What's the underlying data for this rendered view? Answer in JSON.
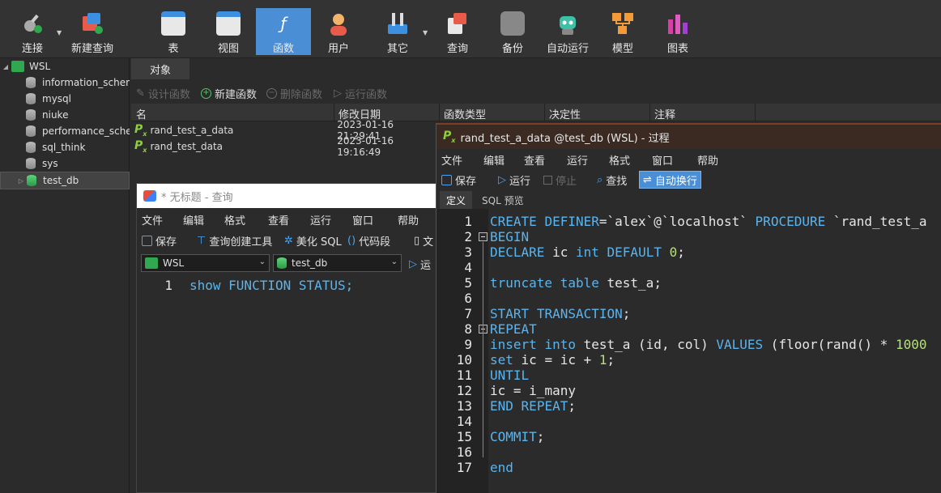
{
  "toolbar": {
    "items": [
      {
        "label": "连接"
      },
      {
        "label": "新建查询"
      },
      {
        "label": "表"
      },
      {
        "label": "视图"
      },
      {
        "label": "函数"
      },
      {
        "label": "用户"
      },
      {
        "label": "其它"
      },
      {
        "label": "查询"
      },
      {
        "label": "备份"
      },
      {
        "label": "自动运行"
      },
      {
        "label": "模型"
      },
      {
        "label": "图表"
      }
    ]
  },
  "tree": {
    "connection": "WSL",
    "databases": [
      "information_schema",
      "mysql",
      "niuke",
      "performance_schema",
      "sql_think",
      "sys",
      "test_db"
    ]
  },
  "objects": {
    "tab": "对象",
    "actions": {
      "design": "设计函数",
      "new": "新建函数",
      "delete": "删除函数",
      "run": "运行函数"
    },
    "columns": {
      "name": "名",
      "modified": "修改日期",
      "type": "函数类型",
      "deterministic": "决定性",
      "comment": "注释"
    },
    "rows": [
      {
        "name": "rand_test_a_data",
        "modified": "2023-01-16 21:29:41"
      },
      {
        "name": "rand_test_data",
        "modified": "2023-01-16 19:16:49"
      }
    ]
  },
  "query_window": {
    "title": "* 无标题 - 查询",
    "menu": [
      "文件",
      "编辑",
      "格式",
      "查看",
      "运行",
      "窗口",
      "帮助"
    ],
    "tools": {
      "save": "保存",
      "builder": "查询创建工具",
      "beautify": "美化 SQL",
      "snippet": "代码段",
      "text": "文",
      "run": "运"
    },
    "connection": "WSL",
    "database": "test_db",
    "line_no": "1",
    "code": "show FUNCTION STATUS;"
  },
  "proc_window": {
    "title": "rand_test_a_data @test_db (WSL) - 过程",
    "menu": [
      "文件",
      "编辑",
      "查看",
      "运行",
      "格式",
      "窗口",
      "帮助"
    ],
    "tools": {
      "save": "保存",
      "run": "运行",
      "stop": "停止",
      "find": "查找",
      "wrap": "自动换行"
    },
    "tabs": {
      "definition": "定义",
      "preview": "SQL 预览"
    },
    "lines": [
      {
        "n": "1",
        "text": "CREATE DEFINER=`alex`@`localhost` PROCEDURE `rand_test_a"
      },
      {
        "n": "2",
        "text": "BEGIN"
      },
      {
        "n": "3",
        "text": "DECLARE ic int DEFAULT 0;"
      },
      {
        "n": "4",
        "text": ""
      },
      {
        "n": "5",
        "text": "truncate table test_a;"
      },
      {
        "n": "6",
        "text": ""
      },
      {
        "n": "7",
        "text": "START TRANSACTION;"
      },
      {
        "n": "8",
        "text": "REPEAT"
      },
      {
        "n": "9",
        "text": "insert into test_a (id, col) VALUES (floor(rand() * 1000"
      },
      {
        "n": "10",
        "text": "set ic = ic + 1;"
      },
      {
        "n": "11",
        "text": "UNTIL"
      },
      {
        "n": "12",
        "text": "ic = i_many"
      },
      {
        "n": "13",
        "text": "END REPEAT;"
      },
      {
        "n": "14",
        "text": ""
      },
      {
        "n": "15",
        "text": "COMMIT;"
      },
      {
        "n": "16",
        "text": ""
      },
      {
        "n": "17",
        "text": "end"
      }
    ]
  }
}
